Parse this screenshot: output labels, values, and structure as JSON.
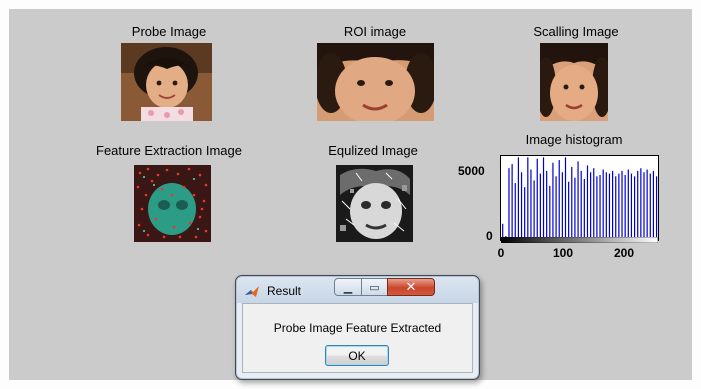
{
  "figure": {
    "panels": [
      {
        "caption": "Probe Image"
      },
      {
        "caption": "ROI image"
      },
      {
        "caption": "Scalling Image"
      },
      {
        "caption": "Feature Extraction Image"
      },
      {
        "caption": "Equlized Image"
      }
    ],
    "background_color": "#cbcbcb"
  },
  "chart_data": {
    "type": "bar",
    "title": "Image histogram",
    "xlabel": "",
    "ylabel": "",
    "xlim": [
      0,
      255
    ],
    "ylim": [
      0,
      6200
    ],
    "xticks": [
      "0",
      "100",
      "200"
    ],
    "yticks": [
      "0",
      "5000"
    ],
    "bar_color": "#0000cc",
    "series": [
      {
        "values": [
          1200,
          300,
          5300,
          5600,
          4200,
          6100,
          5000,
          3900,
          6100,
          5200,
          4400,
          6000,
          4900,
          6100,
          5100,
          4000,
          5700,
          4700,
          5900,
          5000,
          6100,
          4300,
          5400,
          4600,
          5800,
          5100,
          4500,
          5500,
          5000,
          5300,
          4700,
          4800,
          5200,
          5000,
          4900,
          5100,
          4700,
          4900,
          5100,
          4800,
          5200,
          4900,
          4700,
          5100,
          5300,
          5000,
          5200,
          4900,
          5100,
          4700
        ]
      }
    ]
  },
  "dialog": {
    "title": "Result",
    "message": "Probe Image Feature Extracted",
    "ok_label": "OK",
    "close_glyph": "✕",
    "minimize_glyph": "▁",
    "maximize_glyph": "▭"
  }
}
